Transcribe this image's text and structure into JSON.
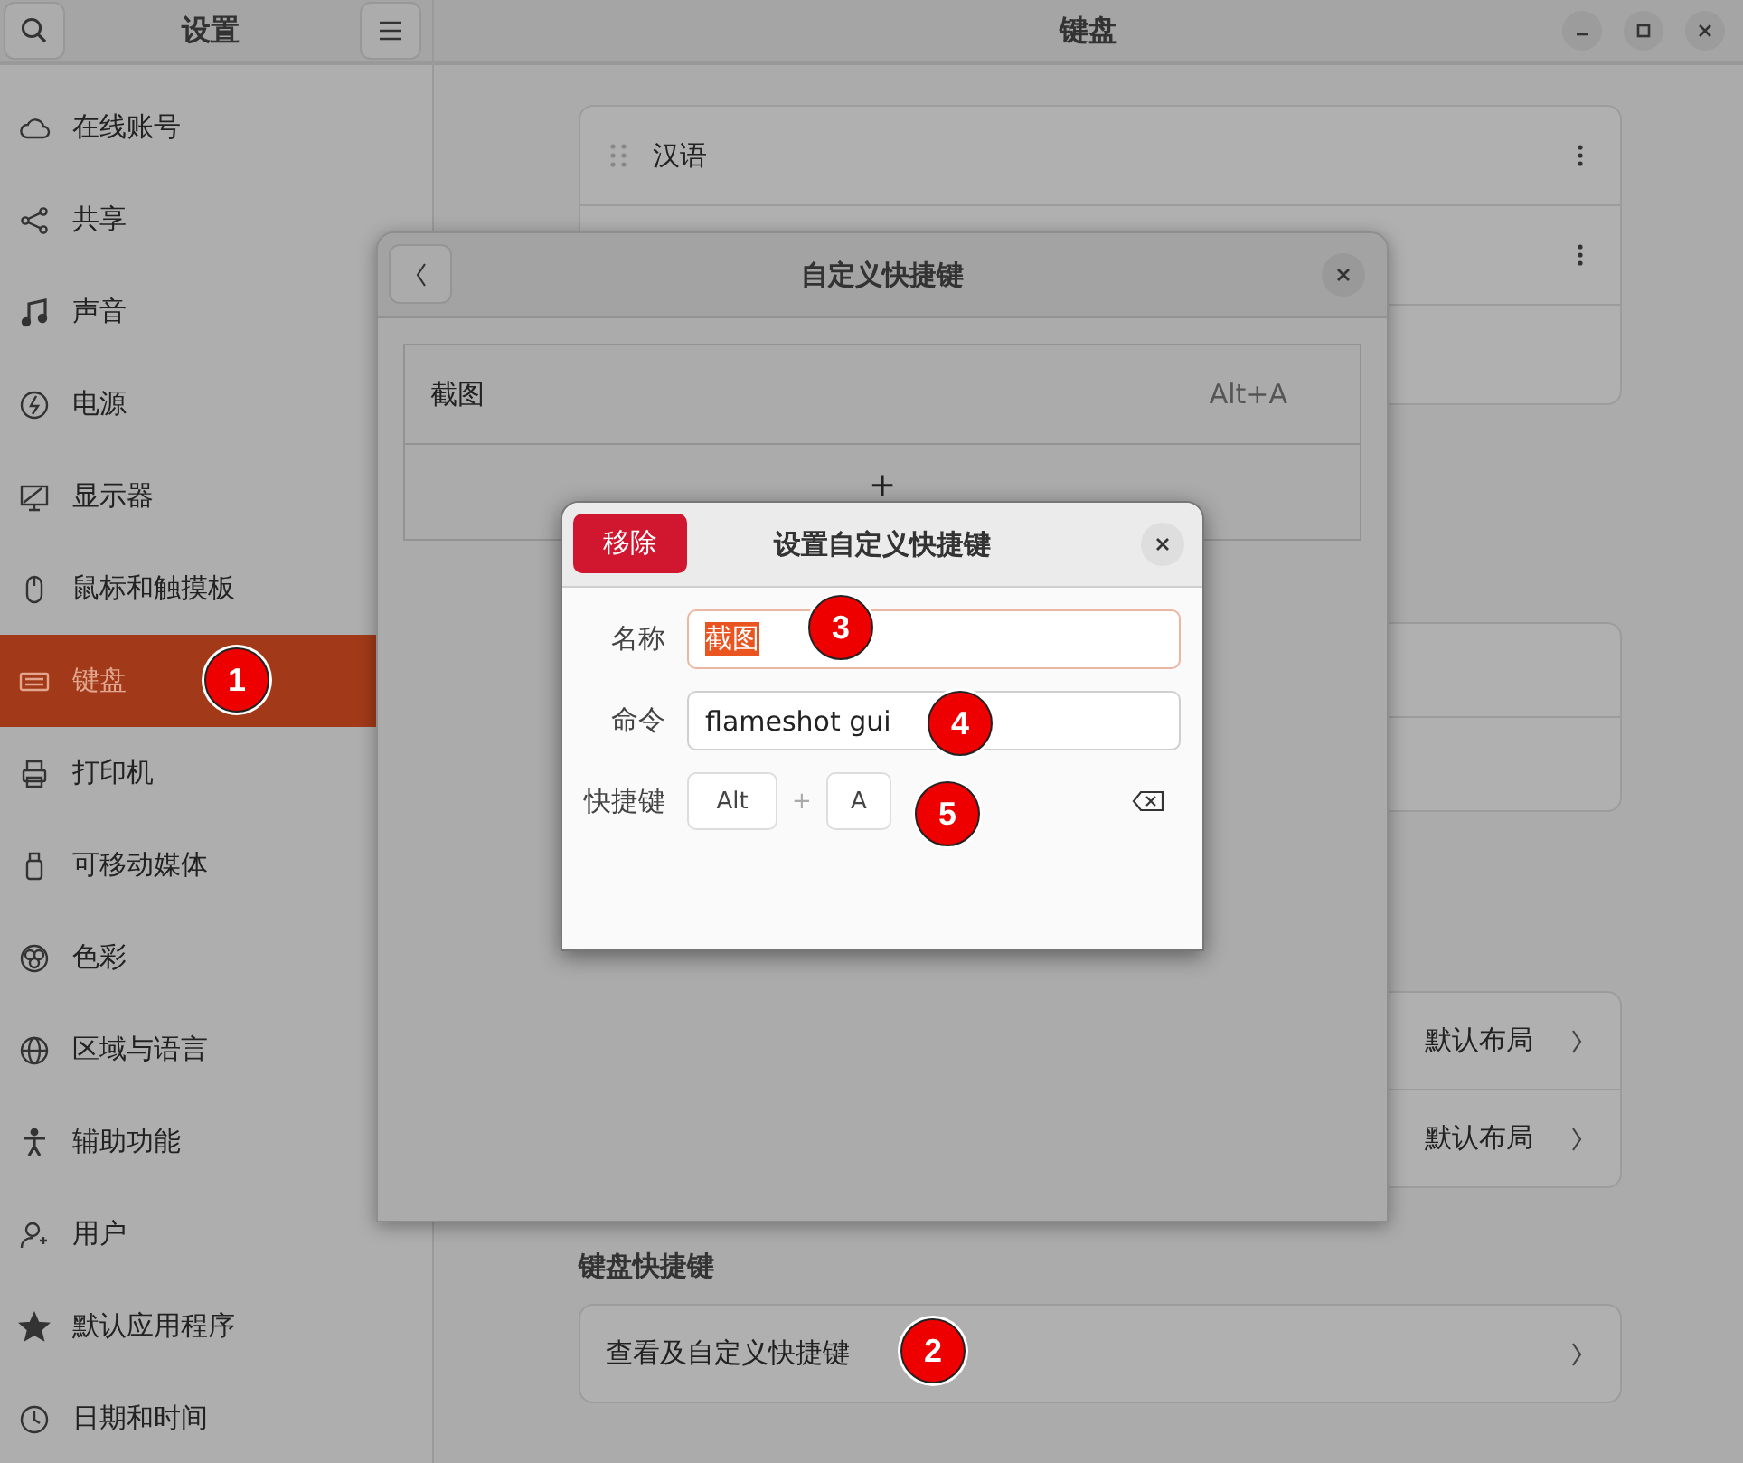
{
  "sidebar": {
    "title": "设置",
    "groups": [
      [
        {
          "label": "在线账号"
        },
        {
          "label": "共享"
        }
      ],
      [
        {
          "label": "声音",
          "selected": false
        },
        {
          "label": "电源",
          "selected": false
        },
        {
          "label": "显示器",
          "selected": false
        },
        {
          "label": "鼠标和触摸板",
          "selected": false
        },
        {
          "label": "键盘",
          "selected": true
        },
        {
          "label": "打印机",
          "selected": false
        },
        {
          "label": "可移动媒体",
          "selected": false
        },
        {
          "label": "色彩",
          "selected": false
        }
      ],
      [
        {
          "label": "区域与语言",
          "selected": false
        },
        {
          "label": "辅助功能",
          "selected": false
        },
        {
          "label": "用户",
          "selected": false
        },
        {
          "label": "默认应用程序",
          "selected": false
        },
        {
          "label": "日期和时间",
          "selected": false
        }
      ]
    ]
  },
  "page": {
    "title": "键盘",
    "input_sources": [
      {
        "kind": "source",
        "label": "汉语"
      },
      {
        "kind": "menu"
      },
      {
        "kind": "blank"
      }
    ],
    "layouts": [
      {
        "value": "默认布局"
      },
      {
        "value": "默认布局"
      }
    ],
    "shortcuts_heading": "键盘快捷键",
    "shortcuts_row": "查看及自定义快捷键"
  },
  "custom_dialog": {
    "title": "自定义快捷键",
    "shortcuts": [
      {
        "name": "截图",
        "accel": "Alt+A"
      }
    ],
    "add_label": "+"
  },
  "edit_dialog": {
    "title": "设置自定义快捷键",
    "remove_button": "移除",
    "name": {
      "label": "名称",
      "value": "截图",
      "text_selected": true
    },
    "command": {
      "label": "命令",
      "value": "flameshot gui"
    },
    "shortcut": {
      "label": "快捷键",
      "keys": [
        "Alt",
        "A"
      ],
      "joiner": "+"
    }
  },
  "callouts": [
    {
      "label": "1"
    },
    {
      "label": "2"
    },
    {
      "label": "3"
    },
    {
      "label": "4"
    },
    {
      "label": "5"
    }
  ]
}
